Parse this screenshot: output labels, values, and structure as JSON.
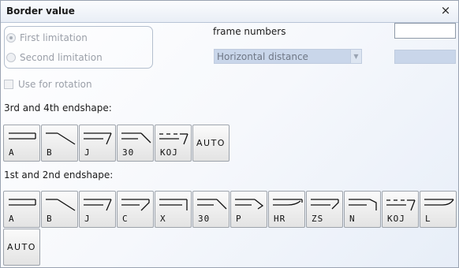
{
  "window": {
    "title": "Border value",
    "close_glyph": "×"
  },
  "limitation": {
    "options": [
      {
        "label": "First limitation",
        "checked": true
      },
      {
        "label": "Second limitation",
        "checked": false
      }
    ]
  },
  "use_for_rotation": {
    "label": "Use for rotation",
    "checked": false
  },
  "frame_numbers": {
    "label": "frame numbers",
    "value": ""
  },
  "distance_combo": {
    "value": "Horizontal distance"
  },
  "distance_value": {
    "value": ""
  },
  "shapes_3_4": {
    "label": "3rd and 4th endshape:",
    "buttons": [
      {
        "label": "A",
        "icon": "endshape-a-icon"
      },
      {
        "label": "B",
        "icon": "endshape-b-icon"
      },
      {
        "label": "J",
        "icon": "endshape-j-icon"
      },
      {
        "label": "30",
        "icon": "endshape-30-icon"
      },
      {
        "label": "KOJ",
        "icon": "endshape-koj-icon"
      },
      {
        "label": "AUTO",
        "icon": ""
      }
    ]
  },
  "shapes_1_2": {
    "label": "1st and 2nd endshape:",
    "buttons": [
      {
        "label": "A",
        "icon": "endshape-a-icon"
      },
      {
        "label": "B",
        "icon": "endshape-b-icon"
      },
      {
        "label": "J",
        "icon": "endshape-j-icon"
      },
      {
        "label": "C",
        "icon": "endshape-c-icon"
      },
      {
        "label": "X",
        "icon": "endshape-x-icon"
      },
      {
        "label": "30",
        "icon": "endshape-30-icon"
      },
      {
        "label": "P",
        "icon": "endshape-p-icon"
      },
      {
        "label": "HR",
        "icon": "endshape-hr-icon"
      },
      {
        "label": "ZS",
        "icon": "endshape-zs-icon"
      },
      {
        "label": "N",
        "icon": "endshape-n-icon"
      },
      {
        "label": "KOJ",
        "icon": "endshape-koj-icon"
      },
      {
        "label": "L",
        "icon": "endshape-l-icon"
      },
      {
        "label": "AUTO",
        "icon": ""
      }
    ]
  },
  "colors": {
    "title_gradient_top": "#fbfcfe",
    "disabled_field": "#c9d6ea",
    "disabled_text": "#9a9fa8"
  }
}
